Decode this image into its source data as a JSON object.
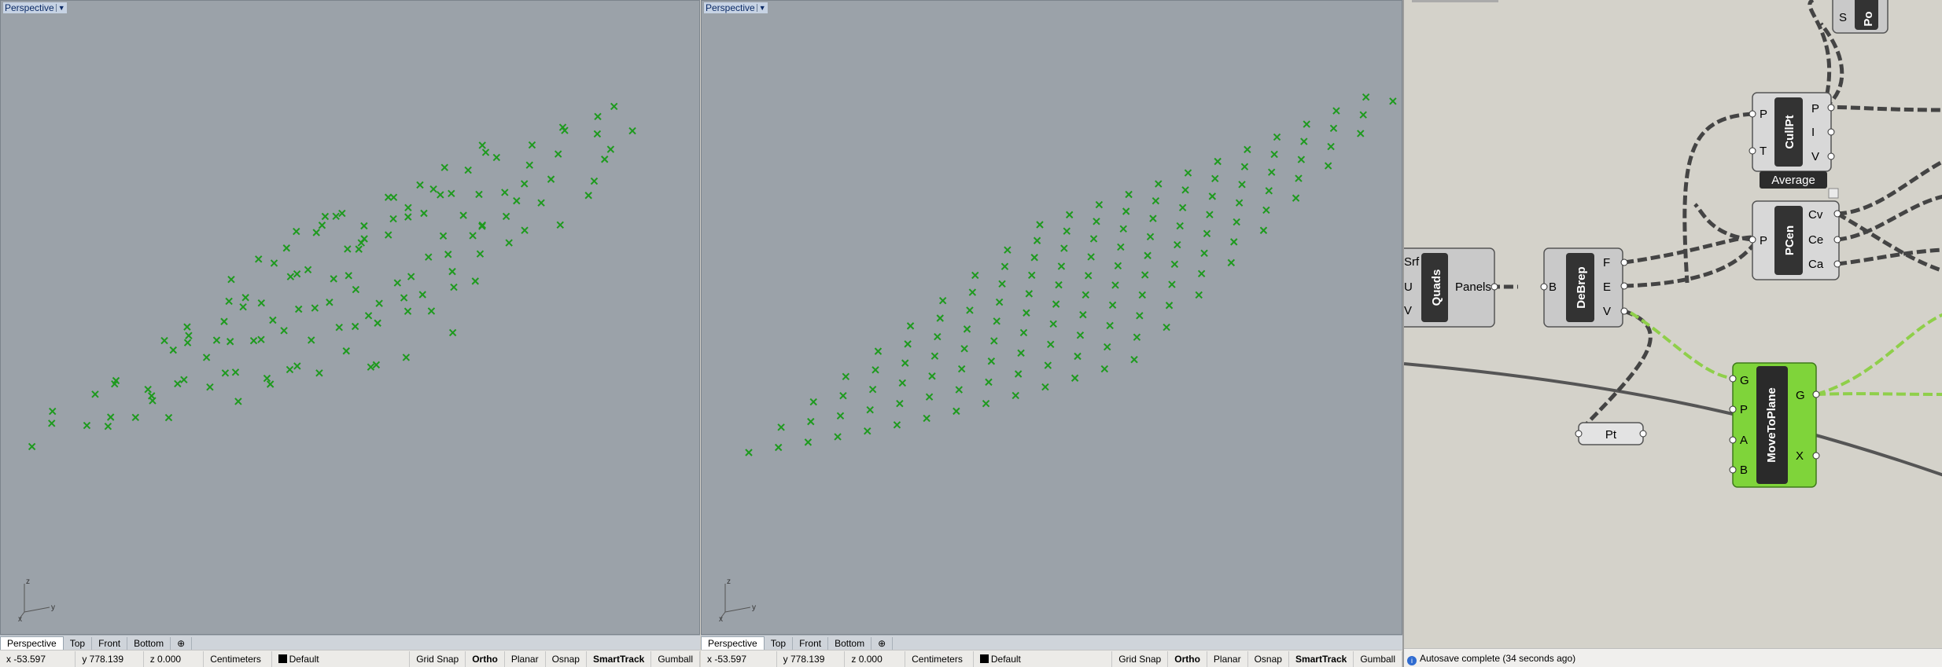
{
  "viewports": [
    {
      "label": "Perspective",
      "tabs": [
        "Perspective",
        "Top",
        "Front",
        "Bottom"
      ],
      "status": {
        "x": "x -53.597",
        "y": "y 778.139",
        "z": "z 0.000",
        "units": "Centimeters",
        "layer": "Default",
        "buttons": [
          "Grid Snap",
          "Ortho",
          "Planar",
          "Osnap",
          "SmartTrack",
          "Gumball"
        ]
      }
    },
    {
      "label": "Perspective",
      "tabs": [
        "Perspective",
        "Top",
        "Front",
        "Bottom"
      ],
      "status": {
        "x": "x -53.597",
        "y": "y 778.139",
        "z": "z 0.000",
        "units": "Centimeters",
        "layer": "Default",
        "buttons": [
          "Grid Snap",
          "Ortho",
          "Planar",
          "Osnap",
          "SmartTrack",
          "Gumball"
        ]
      }
    }
  ],
  "axes": {
    "x": "x",
    "y": "y",
    "z": "z"
  },
  "grasshopper": {
    "components": {
      "quads": {
        "title": "Quads",
        "inputs": [
          "Srf",
          "U",
          "V"
        ],
        "outputs": [
          "Panels"
        ]
      },
      "debrep": {
        "title": "DeBrep",
        "inputs": [
          "B"
        ],
        "outputs": [
          "F",
          "E",
          "V"
        ]
      },
      "cullpt": {
        "title": "CullPt",
        "inputs": [
          "P",
          "T"
        ],
        "outputs": [
          "P",
          "I",
          "V"
        ],
        "tooltip": "Average"
      },
      "pcen": {
        "title": "PCen",
        "inputs": [
          "P"
        ],
        "outputs": [
          "Cv",
          "Ce",
          "Ca"
        ]
      },
      "movetoplane": {
        "title": "MoveToPlane",
        "inputs": [
          "G",
          "P",
          "A",
          "B"
        ],
        "outputs": [
          "G",
          "X"
        ]
      },
      "pt": {
        "title": "Pt"
      },
      "top_node": {
        "input": "S",
        "title": "Po"
      }
    },
    "status": "Autosave complete (34 seconds ago)"
  },
  "colors": {
    "viewport_bg": "#9ba2a9",
    "point": "#1e9a1e",
    "canvas": "#d4d2ca",
    "selected_component": "#7fd43a"
  }
}
